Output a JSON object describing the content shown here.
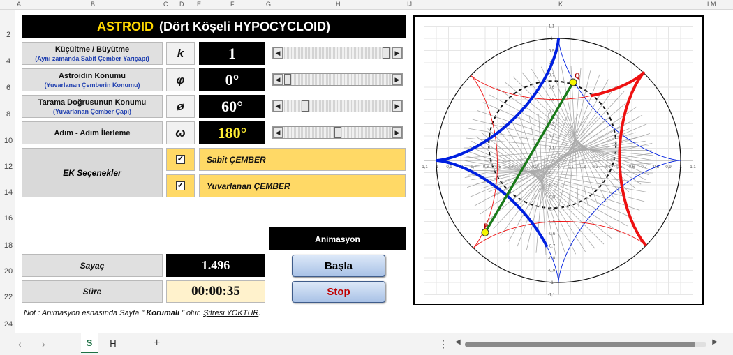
{
  "title": {
    "highlight": "ASTROID",
    "rest": "(Dört Köşeli HYPOCYCLOID)"
  },
  "columns": [
    "A",
    "B",
    "C",
    "D",
    "E",
    "F",
    "G",
    "H",
    "IJ",
    "K",
    "LM"
  ],
  "rows": [
    "2",
    "4",
    "6",
    "8",
    "10",
    "12",
    "14",
    "16",
    "18",
    "20",
    "22",
    "24"
  ],
  "params": [
    {
      "label": "Küçültme / Büyütme",
      "sub": "(Aynı zamanda Sabit Çember Yarıçapı)",
      "symbol": "k",
      "value": "1",
      "thumb": 0.95
    },
    {
      "label": "Astroidin Konumu",
      "sub": "(Yuvarlanan Çemberin Konumu)",
      "symbol": "φ",
      "value": "0°",
      "thumb": 0.0
    },
    {
      "label": "Tarama Doğrusunun Konumu",
      "sub": "(Yuvarlanan Çember Çapı)",
      "symbol": "ø",
      "value": "60°",
      "thumb": 0.2
    },
    {
      "label": "Adım - Adım İlerleme",
      "sub": "",
      "symbol": "ω",
      "value": "180°",
      "thumb": 0.5
    }
  ],
  "options": {
    "group_label": "EK  Seçenekler",
    "items": [
      {
        "label": "Sabit ÇEMBER",
        "checked": "✓"
      },
      {
        "label": "Yuvarlanan ÇEMBER",
        "checked": "✓"
      }
    ]
  },
  "animation": {
    "header": "Animasyon",
    "start": "Başla",
    "stop": "Stop",
    "stop_color": "#c00000"
  },
  "counter": {
    "label": "Sayaç",
    "value": "1.496"
  },
  "duration": {
    "label": "Süre",
    "value": "00:00:35"
  },
  "note": {
    "prefix": "Not : Animasyon esnasında Sayfa \"",
    "bold": " Korumalı ",
    "middle": "\" olur.  ",
    "link": "Şifresi YOKTUR",
    "suffix": "."
  },
  "chart": {
    "ticks": [
      "-1,1",
      "-1",
      "-0,9",
      "-0,8",
      "-0,7",
      "-0,6",
      "-0,5",
      "-0,4",
      "-0,3",
      "-0,2",
      "-0,1",
      "0",
      "0,1",
      "0,2",
      "0,3",
      "0,4",
      "0,5",
      "0,6",
      "0,7",
      "0,8",
      "0,9",
      "1",
      "1,1"
    ],
    "point_q": "Q",
    "point_p": "P",
    "colors": {
      "astroid_blue": "#0020e0",
      "astroid_red": "#ee1111",
      "chord": "#1a7a1a",
      "lines": "#aaaaaa",
      "point": "#f5f500"
    }
  },
  "tabs": {
    "items": [
      "S",
      "H"
    ],
    "add": "+",
    "prev": "‹",
    "next": "›",
    "menu": "⋮"
  }
}
